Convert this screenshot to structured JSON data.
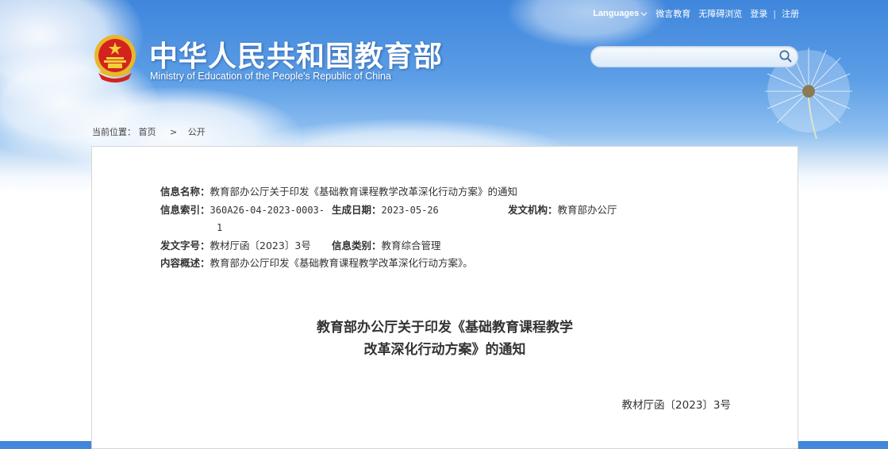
{
  "header": {
    "title_cn": "中华人民共和国教育部",
    "title_en": "Ministry of Education of the People's Republic of China",
    "nav": {
      "languages": "Languages",
      "weibo": "微言教育",
      "accessibility": "无障碍浏览",
      "login": "登录",
      "separator": "|",
      "register": "注册"
    },
    "search": {
      "placeholder": "",
      "value": ""
    }
  },
  "breadcrumb": {
    "label": "当前位置：",
    "home": "首页",
    "arrow": ">",
    "current": "公开"
  },
  "info": {
    "name_label": "信息名称：",
    "name_value": "教育部办公厅关于印发《基础教育课程教学改革深化行动方案》的通知",
    "index_label": "信息索引：",
    "index_value_line1": "360A26-04-2023-0003-",
    "index_value_line2": "1",
    "date_label": "生成日期：",
    "date_value": "2023-05-26",
    "issuer_label": "发文机构：",
    "issuer_value": "教育部办公厅",
    "docno_label": "发文字号：",
    "docno_value": "教材厅函〔2023〕3号",
    "category_label": "信息类别：",
    "category_value": "教育综合管理",
    "summary_label": "内容概述：",
    "summary_value": "教育部办公厅印发《基础教育课程教学改革深化行动方案》。"
  },
  "document": {
    "title_line1": "教育部办公厅关于印发《基础教育课程教学",
    "title_line2": "改革深化行动方案》的通知",
    "number": "教材厅函〔2023〕3号"
  }
}
